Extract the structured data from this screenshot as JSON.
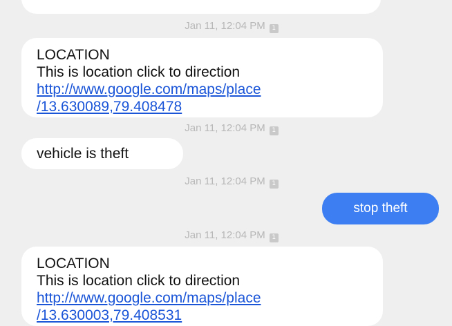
{
  "conversation": {
    "sim_icon_label": "1",
    "messages": [
      {
        "timestamp": "Jan 11, 12:04 PM",
        "direction": "incoming",
        "lines": [
          "LOCATION",
          "This is location click to direction"
        ],
        "link_lines": [
          "http://www.google.com/maps/place",
          "/13.630089,79.408478"
        ]
      },
      {
        "timestamp": "Jan 11, 12:04 PM",
        "direction": "incoming",
        "text": "vehicle is theft"
      },
      {
        "timestamp": "Jan 11, 12:04 PM",
        "direction": "outgoing",
        "text": "stop theft"
      },
      {
        "timestamp": "Jan 11, 12:04 PM",
        "direction": "incoming",
        "lines": [
          "LOCATION",
          "This is location click to direction"
        ],
        "link_lines": [
          "http://www.google.com/maps/place",
          "/13.630003,79.408531"
        ]
      }
    ]
  },
  "colors": {
    "background": "#efefef",
    "incoming_bubble": "#ffffff",
    "outgoing_bubble": "#3d7ff2",
    "link": "#1a55d8",
    "timestamp": "#b7b7b7"
  }
}
